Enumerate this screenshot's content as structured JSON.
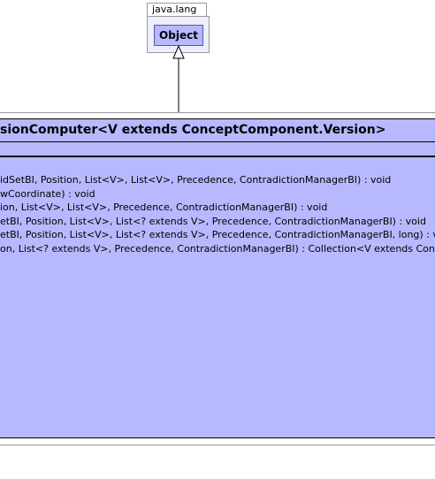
{
  "package": {
    "name": "java.lang"
  },
  "superclass": {
    "name": "Object"
  },
  "class": {
    "title": "sionComputer<V extends ConceptComponent.Version>",
    "methods": [
      "idSetBI, Position, List<V>, List<V>, Precedence, ContradictionManagerBI) : void",
      "wCoordinate) : void",
      "ion, List<V>, List<V>, Precedence, ContradictionManagerBI) : void",
      "etBI, Position, List<V>, List<? extends V>, Precedence, ContradictionManagerBI) : void",
      "etBI, Position, List<V>, List<? extends V>, Precedence, ContradictionManagerBI, long) : vo",
      "on, List<? extends V>, Precedence, ContradictionManagerBI) : Collection<V extends Conce"
    ]
  },
  "colors": {
    "class_fill": "#b8b8ff",
    "package_fill": "#eeeeff",
    "border": "#000000"
  }
}
